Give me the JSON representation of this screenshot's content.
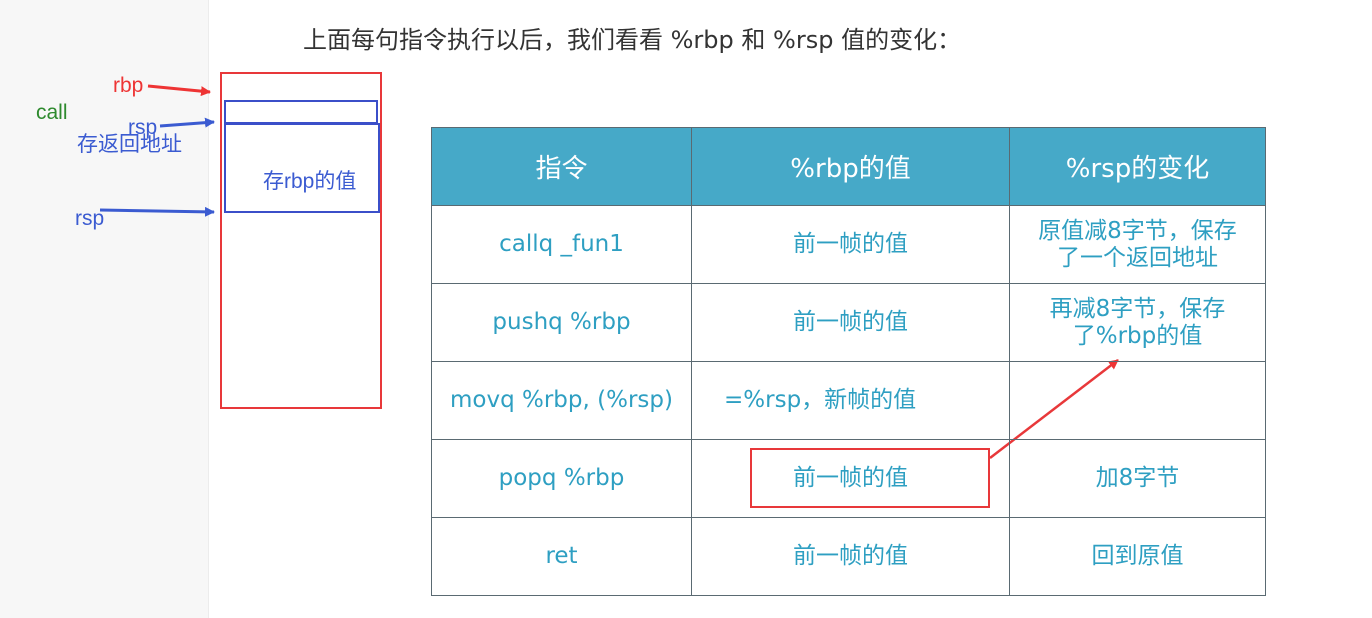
{
  "heading": "上面每句指令执行以后，我们看看 %rbp 和 %rsp 值的变化：",
  "diagram": {
    "rbp_label": "rbp",
    "call_label": "call",
    "rsp_top_label": "rsp",
    "ret_addr_label": "存返回地址",
    "saved_rbp_label": "存rbp的值",
    "rsp_bottom_label": "rsp"
  },
  "table": {
    "headers": [
      "指令",
      "%rbp的值",
      "%rsp的变化"
    ],
    "rows": [
      {
        "instr": "callq _fun1",
        "rbp": "前一帧的值",
        "rsp": [
          "原值减8字节，保存",
          "了一个返回地址"
        ]
      },
      {
        "instr": "pushq %rbp",
        "rbp": "前一帧的值",
        "rsp": [
          "再减8字节，保存",
          "了%rbp的值"
        ]
      },
      {
        "instr": "movq %rbp, (%rsp)",
        "rbp": "=%rsp，新帧的值",
        "rsp": [
          "",
          ""
        ]
      },
      {
        "instr": "popq %rbp",
        "rbp": "前一帧的值",
        "rsp": [
          "加8字节",
          ""
        ]
      },
      {
        "instr": "ret",
        "rbp": "前一帧的值",
        "rsp": [
          "回到原值",
          ""
        ]
      }
    ]
  },
  "colors": {
    "header_bg": "#46a9c8",
    "cell_text": "#2e9fc2",
    "annotation_red": "#e8383a",
    "annotation_blue": "#3b4fc9"
  }
}
